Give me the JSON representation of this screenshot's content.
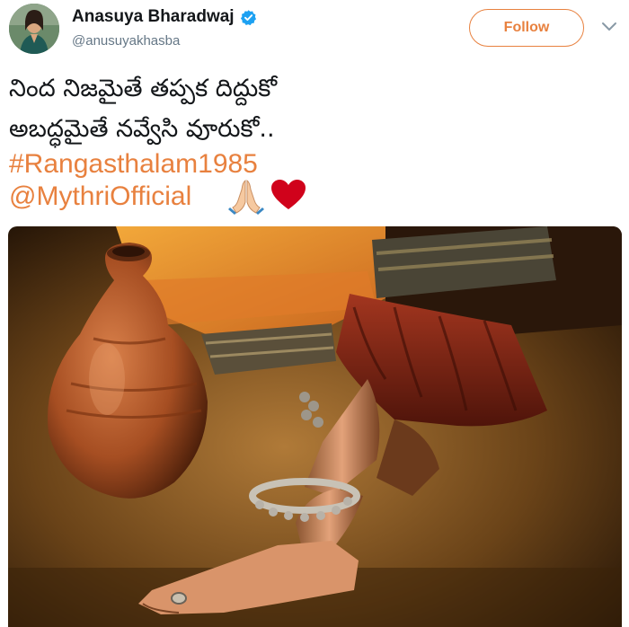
{
  "author": {
    "name": "Anasuya Bharadwaj",
    "handle": "@anusuyakhasba",
    "avatar_icon": "profile-avatar",
    "verified_icon": "verified-badge-icon"
  },
  "actions": {
    "follow_label": "Follow",
    "menu_icon": "chevron-down-icon"
  },
  "tweet": {
    "line1": "నింద నిజమైతే తప్పక దిద్దుకో",
    "line2": "అబద్ధమైతే నవ్వేసి వూరుకో..",
    "hashtag": "#Rangasthalam1985",
    "mention": "@MythriOfficial",
    "emojis": [
      "folded-hands-icon",
      "red-heart-icon"
    ]
  },
  "media": {
    "type": "photo",
    "icon": "clay-pot-and-anklet-photo"
  },
  "colors": {
    "accent": "#e8813f",
    "verified": "#1da1f2",
    "name_text": "#14171a",
    "secondary_text": "#657786",
    "heart": "#d0021b"
  }
}
